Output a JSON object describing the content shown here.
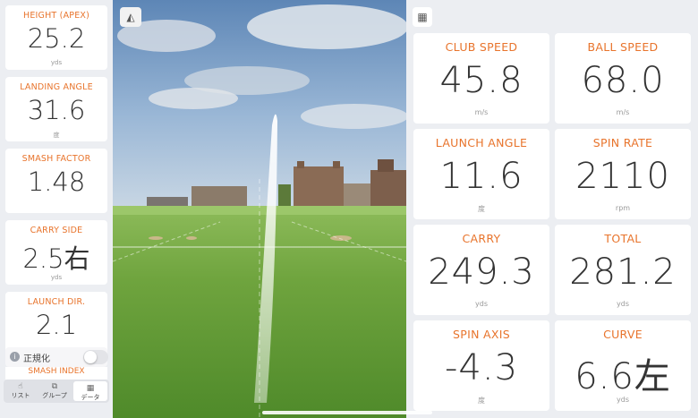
{
  "left_metrics": [
    {
      "label": "HEIGHT (APEX)",
      "value": "25.2",
      "unit": "yds"
    },
    {
      "label": "LANDING ANGLE",
      "value": "31.6",
      "unit": "度"
    },
    {
      "label": "SMASH FACTOR",
      "value": "1.48",
      "unit": ""
    },
    {
      "label": "CARRY SIDE",
      "value": "2.5右",
      "unit": "yds"
    },
    {
      "label": "LAUNCH DIR.",
      "value": "2.1",
      "unit": ""
    }
  ],
  "normalize": {
    "label": "正規化",
    "enabled": false
  },
  "partial_card": {
    "label": "SMASH INDEX"
  },
  "bottom_tabs": [
    {
      "label": "リスト",
      "icon": "list-icon"
    },
    {
      "label": "グループ",
      "icon": "group-icon"
    },
    {
      "label": "データ",
      "icon": "data-icon",
      "active": true
    }
  ],
  "right_metrics": [
    {
      "label": "CLUB SPEED",
      "value": "45.8",
      "unit": "m/s"
    },
    {
      "label": "BALL SPEED",
      "value": "68.0",
      "unit": "m/s"
    },
    {
      "label": "LAUNCH ANGLE",
      "value": "11.6",
      "unit": "度"
    },
    {
      "label": "SPIN RATE",
      "value": "2110",
      "unit": "rpm"
    },
    {
      "label": "CARRY",
      "value": "249.3",
      "unit": "yds"
    },
    {
      "label": "TOTAL",
      "value": "281.2",
      "unit": "yds"
    },
    {
      "label": "SPIN AXIS",
      "value": "-4.3",
      "unit": "度"
    },
    {
      "label": "CURVE",
      "value": "6.6左",
      "unit": "yds"
    }
  ],
  "colors": {
    "accent": "#e8742c",
    "value_text": "#333333",
    "panel_bg": "#eceef2"
  }
}
